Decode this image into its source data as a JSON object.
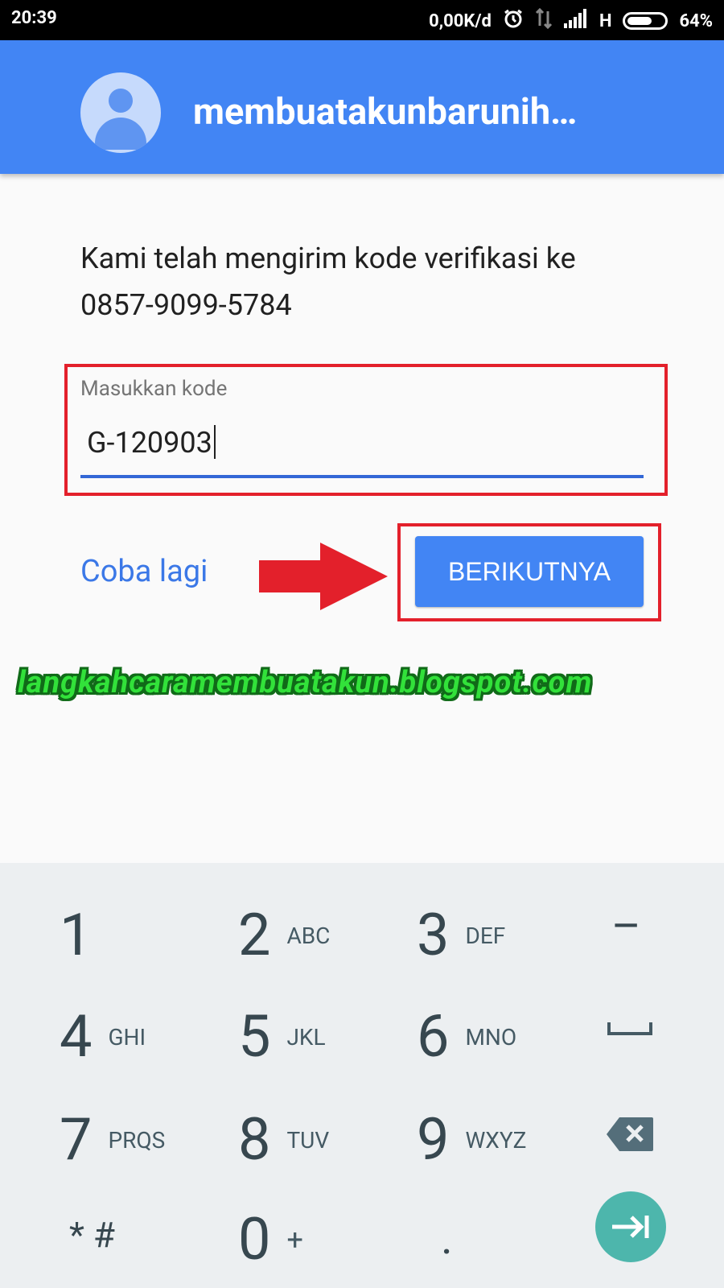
{
  "status_bar": {
    "time": "20:39",
    "speed": "0,00K/d",
    "network": "H",
    "battery": "64%",
    "icons": [
      "alarm-icon",
      "data-arrows-icon",
      "signal-icon",
      "battery-icon"
    ]
  },
  "app_bar": {
    "title": "membuatakunbarunih…",
    "avatar_icon": "account-avatar-icon",
    "color": "#4285f4"
  },
  "verification": {
    "message_line1": "Kami telah mengirim kode verifikasi ke",
    "message_line2": "0857-9099-5784"
  },
  "code_field": {
    "label": "Masukkan kode",
    "value": "G-120903"
  },
  "actions": {
    "retry_label": "Coba lagi",
    "next_label": "BERIKUTNYA"
  },
  "watermark": "langkahcaramembuatakun.blogspot.com",
  "keypad": {
    "keys": [
      {
        "num": "1",
        "letters": ""
      },
      {
        "num": "2",
        "letters": "ABC"
      },
      {
        "num": "3",
        "letters": "DEF"
      },
      {
        "num": "–",
        "letters": ""
      },
      {
        "num": "4",
        "letters": "GHI"
      },
      {
        "num": "5",
        "letters": "JKL"
      },
      {
        "num": "6",
        "letters": "MNO"
      },
      {
        "num": "␣",
        "letters": ""
      },
      {
        "num": "7",
        "letters": "PRQS"
      },
      {
        "num": "8",
        "letters": "TUV"
      },
      {
        "num": "9",
        "letters": "WXYZ"
      },
      {
        "num": "⌫",
        "letters": ""
      },
      {
        "num": "* #",
        "letters": ""
      },
      {
        "num": "0",
        "letters": "+"
      },
      {
        "num": ".",
        "letters": ""
      }
    ],
    "fab_icon": "next-field-icon",
    "accent": "#4db6ac"
  }
}
